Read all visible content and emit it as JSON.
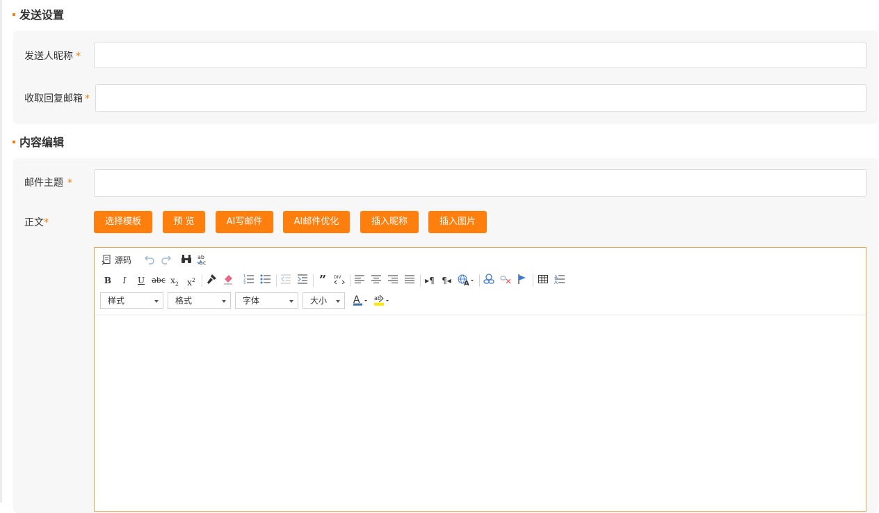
{
  "send_settings": {
    "title": "发送设置",
    "sender_nickname_label": "发送人昵称",
    "reply_email_label": "收取回复邮箱",
    "required_mark": "*"
  },
  "content_edit": {
    "title": "内容编辑",
    "subject_label": "邮件主题",
    "body_label": "正文",
    "buttons": {
      "choose_template": "选择模板",
      "preview": "预 览",
      "ai_write": "AI写邮件",
      "ai_optimize": "AI邮件优化",
      "insert_nickname": "插入昵称",
      "insert_image": "插入图片"
    }
  },
  "editor": {
    "source_label": "源码",
    "selects": {
      "style": "样式",
      "format": "格式",
      "font": "字体",
      "size": "大小"
    }
  },
  "colors": {
    "accent": "#ff7f0e",
    "panel_bg": "#f7f7f7",
    "editor_border": "#f0a54a"
  }
}
